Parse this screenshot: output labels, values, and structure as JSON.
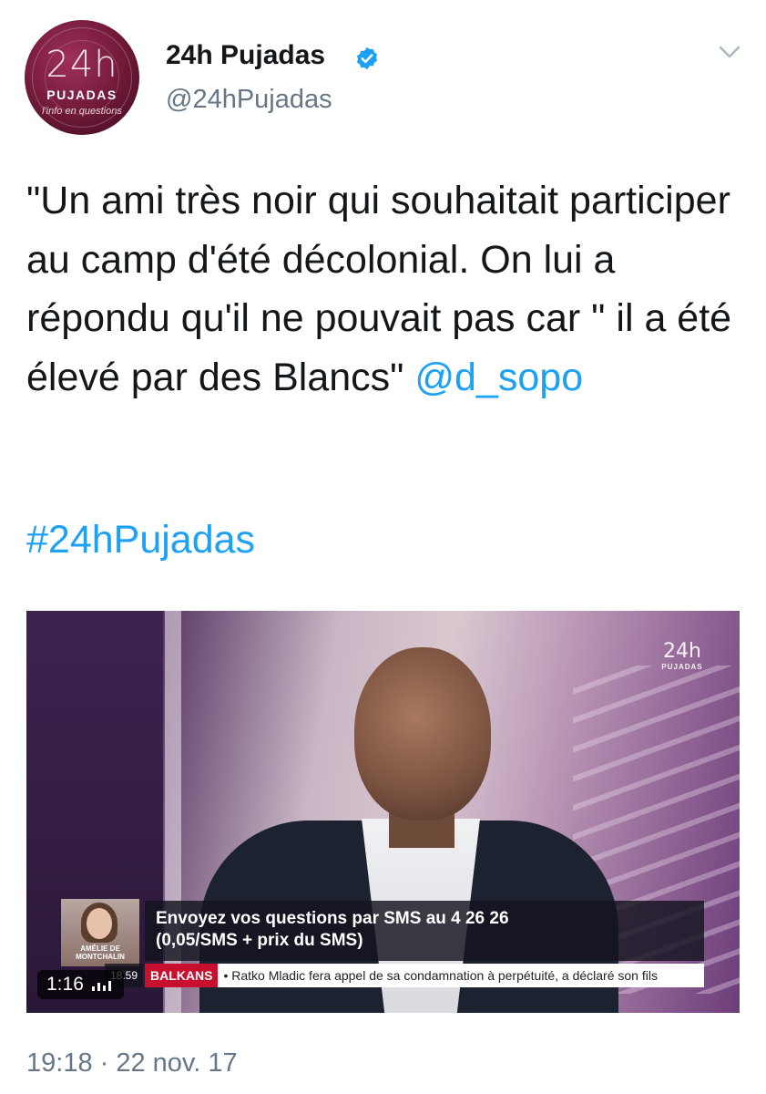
{
  "colors": {
    "link": "#1da1f2",
    "secondary_text": "#657786",
    "primary_text": "#14171a",
    "avatar": "#6e1838"
  },
  "author": {
    "display_name": "24h Pujadas",
    "handle": "@24hPujadas",
    "verified_icon": "verified-badge-icon",
    "avatar": {
      "logo_num": "24h",
      "logo_name": "PUJADAS",
      "logo_sub": "l'info en questions"
    }
  },
  "tweet": {
    "text_main": "\"Un ami très noir qui souhaitait participer au camp d'été décolonial. On lui a répondu qu'il ne pouvait pas car \" il a été élevé par des Blancs\" ",
    "mention": "@d_sopo",
    "hashtag": "#24hPujadas",
    "timestamp": "19:18 · 22 nov. 17"
  },
  "video": {
    "corner_logo_num": "24h",
    "corner_logo_sub": "PUJADAS",
    "guest_name": "AMÉLIE DE MONTCHALIN",
    "sms_line1": "Envoyez vos questions par SMS au 4 26 26",
    "sms_line2": "(0,05/SMS + prix du SMS)",
    "clock": "18.59",
    "ticker_tag": "BALKANS",
    "ticker_text": "• Ratko Mladic fera appel de sa condamnation à perpétuité, a déclaré son fils",
    "duration": "1:16",
    "volume_icon": "volume-bars-icon"
  }
}
